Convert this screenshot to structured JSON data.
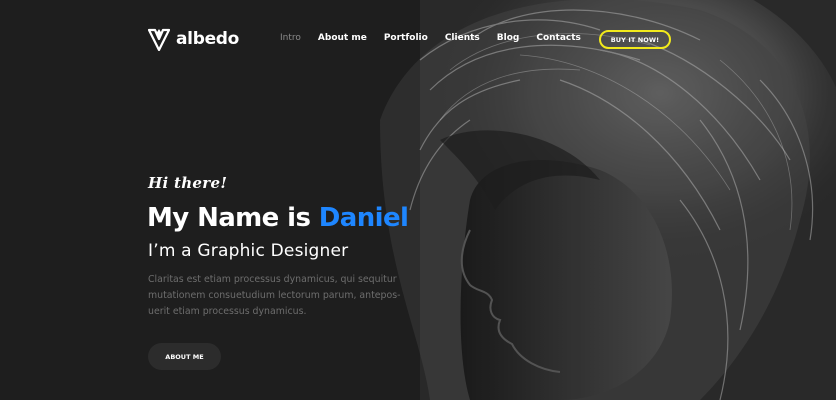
{
  "brand": {
    "name": "albedo",
    "logo_icon": "albedo-logo-mark-icon"
  },
  "nav": {
    "items": [
      {
        "label": "Intro",
        "active": true
      },
      {
        "label": "About me",
        "active": false
      },
      {
        "label": "Portfolio",
        "active": false
      },
      {
        "label": "Clients",
        "active": false
      },
      {
        "label": "Blog",
        "active": false
      },
      {
        "label": "Contacts",
        "active": false
      }
    ]
  },
  "header": {
    "cta_label": "BUY IT NOW!"
  },
  "hero": {
    "greeting": "Hi there!",
    "headline_prefix": "My Name is ",
    "headline_name": "Daniel",
    "subheadline": "I’m a Graphic Designer",
    "bio_lines": [
      "Claritas est etiam processus dynamicus, qui sequitur",
      "mutationem consuetudium lectorum parum, antepos-",
      "uerit etiam processus dynamicus."
    ],
    "about_button_label": "ABOUT ME"
  },
  "colors": {
    "background": "#1f1f1f",
    "accent_blue": "#1e86ff",
    "cta_border_yellow": "#f2ea1b",
    "muted_text": "#6d6d6d"
  }
}
